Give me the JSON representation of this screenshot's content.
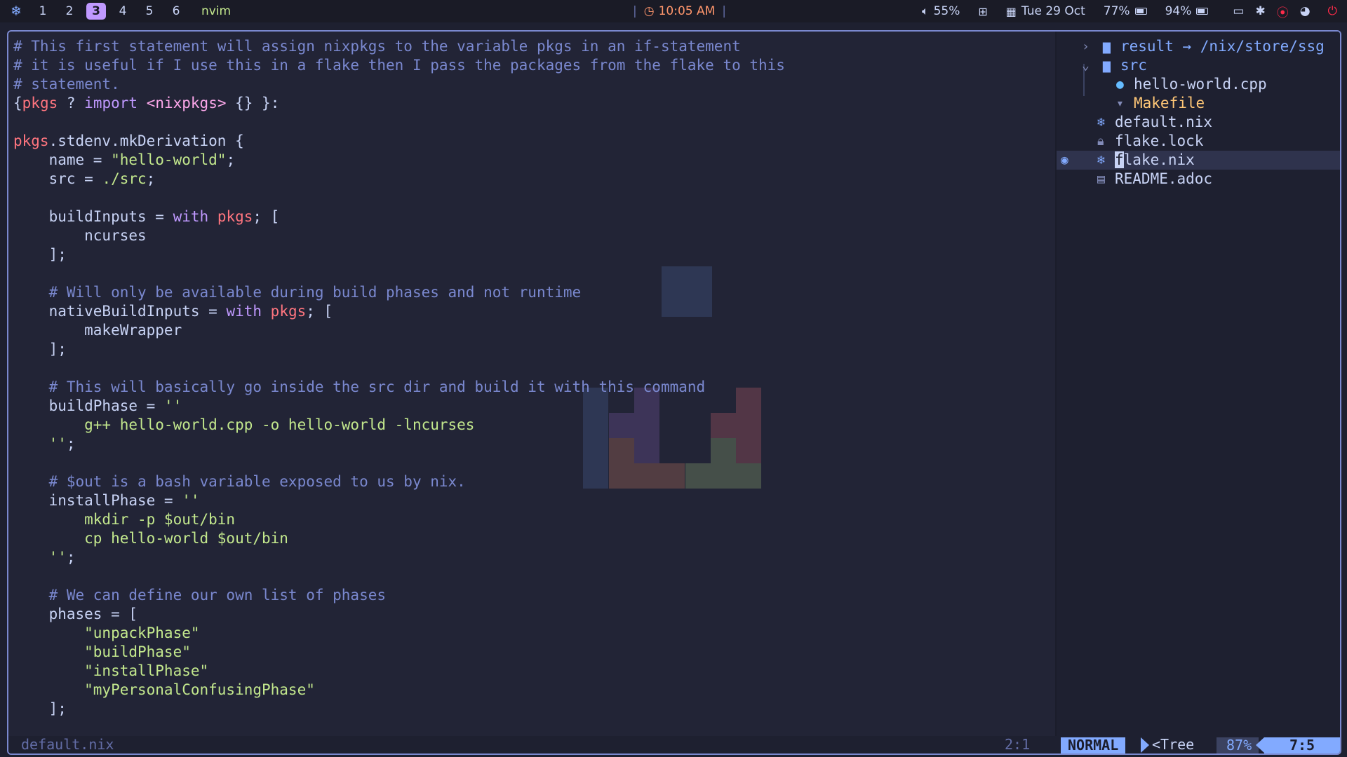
{
  "topbar": {
    "logo_icon": "nix-snowflake-icon",
    "workspaces": [
      "1",
      "2",
      "3",
      "4",
      "5",
      "6"
    ],
    "active_workspace": "3",
    "window_name": "nvim",
    "clock": "10:05 AM",
    "volume": "55%",
    "date": "Tue 29 Oct",
    "battery1": "77%",
    "battery2": "94%"
  },
  "editor": {
    "lines": [
      [
        [
          "c",
          "# This first statement will assign nixpkgs to the variable pkgs in an if-statement"
        ]
      ],
      [
        [
          "c",
          "# it is useful if I use this in a flake then I pass the packages from the flake to this"
        ]
      ],
      [
        [
          "c",
          "# statement."
        ]
      ],
      [
        [
          "v",
          "{"
        ],
        [
          "p",
          "pkgs"
        ],
        [
          "v",
          " ? "
        ],
        [
          "k",
          "import"
        ],
        [
          "v",
          " "
        ],
        [
          "pink",
          "<nixpkgs>"
        ],
        [
          "v",
          " {} }:"
        ]
      ],
      [],
      [
        [
          "p",
          "pkgs"
        ],
        [
          "v",
          ".stdenv.mkDerivation {"
        ]
      ],
      [
        [
          "v",
          "    name = "
        ],
        [
          "s",
          "\"hello-world\""
        ],
        [
          "v",
          ";"
        ]
      ],
      [
        [
          "v",
          "    src = "
        ],
        [
          "s",
          "./src"
        ],
        [
          "v",
          ";"
        ]
      ],
      [],
      [
        [
          "v",
          "    buildInputs = "
        ],
        [
          "k",
          "with"
        ],
        [
          "v",
          " "
        ],
        [
          "p",
          "pkgs"
        ],
        [
          "v",
          "; ["
        ]
      ],
      [
        [
          "v",
          "        ncurses"
        ]
      ],
      [
        [
          "v",
          "    ];"
        ]
      ],
      [],
      [
        [
          "c",
          "    # Will only be available during build phases and not runtime"
        ]
      ],
      [
        [
          "v",
          "    nativeBuildInputs = "
        ],
        [
          "k",
          "with"
        ],
        [
          "v",
          " "
        ],
        [
          "p",
          "pkgs"
        ],
        [
          "v",
          "; ["
        ]
      ],
      [
        [
          "v",
          "        makeWrapper"
        ]
      ],
      [
        [
          "v",
          "    ];"
        ]
      ],
      [],
      [
        [
          "c",
          "    # This will basically go inside the src dir and build it with this command"
        ]
      ],
      [
        [
          "v",
          "    buildPhase = "
        ],
        [
          "s",
          "''"
        ]
      ],
      [
        [
          "s",
          "        g++ hello-world.cpp -o hello-world -lncurses"
        ]
      ],
      [
        [
          "s",
          "    ''"
        ],
        [
          "v",
          ";"
        ]
      ],
      [],
      [
        [
          "c",
          "    # $out is a bash variable exposed to us by nix."
        ]
      ],
      [
        [
          "v",
          "    installPhase = "
        ],
        [
          "s",
          "''"
        ]
      ],
      [
        [
          "s",
          "        mkdir -p $out/bin"
        ]
      ],
      [
        [
          "s",
          "        cp hello-world $out/bin"
        ]
      ],
      [
        [
          "s",
          "    ''"
        ],
        [
          "v",
          ";"
        ]
      ],
      [],
      [
        [
          "c",
          "    # We can define our own list of phases"
        ]
      ],
      [
        [
          "v",
          "    phases = ["
        ]
      ],
      [
        [
          "s",
          "        \"unpackPhase\""
        ]
      ],
      [
        [
          "s",
          "        \"buildPhase\""
        ]
      ],
      [
        [
          "s",
          "        \"installPhase\""
        ]
      ],
      [
        [
          "s",
          "        \"myPersonalConfusingPhase\""
        ]
      ],
      [
        [
          "v",
          "    ];"
        ]
      ]
    ]
  },
  "tree": {
    "items": [
      {
        "name": "result → /nix/store/ssg",
        "icon": "folder-icon",
        "chev": "›",
        "color": "#82aaff",
        "indent": 0
      },
      {
        "name": "src",
        "icon": "folder-open-icon",
        "chev": "⌄",
        "color": "#82aaff",
        "indent": 0
      },
      {
        "name": "hello-world.cpp",
        "icon": "cpp-file-icon",
        "chev": "",
        "color": "#c8d3f5",
        "indent": 2
      },
      {
        "name": "Makefile",
        "icon": "makefile-icon",
        "chev": "",
        "color": "#ffc777",
        "indent": 2
      },
      {
        "name": "default.nix",
        "icon": "nix-file-icon",
        "chev": "",
        "color": "#c8d3f5",
        "indent": 1
      },
      {
        "name": "flake.lock",
        "icon": "lock-icon",
        "chev": "",
        "color": "#c8d3f5",
        "indent": 1
      },
      {
        "name": "flake.nix",
        "icon": "nix-file-icon",
        "chev": "",
        "color": "#c8d3f5",
        "indent": 1
      },
      {
        "name": "README.adoc",
        "icon": "document-icon",
        "chev": "",
        "color": "#c8d3f5",
        "indent": 1
      }
    ],
    "selected_index": 6
  },
  "status": {
    "filename": "default.nix",
    "cursor_left": "2:1",
    "mode": "NORMAL",
    "tree_label": "<Tree",
    "percent": "87%",
    "cursor_right": "7:5"
  },
  "colors": {
    "accent": "#82aaff",
    "workspace_active": "#c099ff",
    "clock": "#ff966c",
    "string": "#c3e88d",
    "comment": "#7a88cf",
    "keyword": "#c099ff",
    "variable": "#ff757f"
  }
}
